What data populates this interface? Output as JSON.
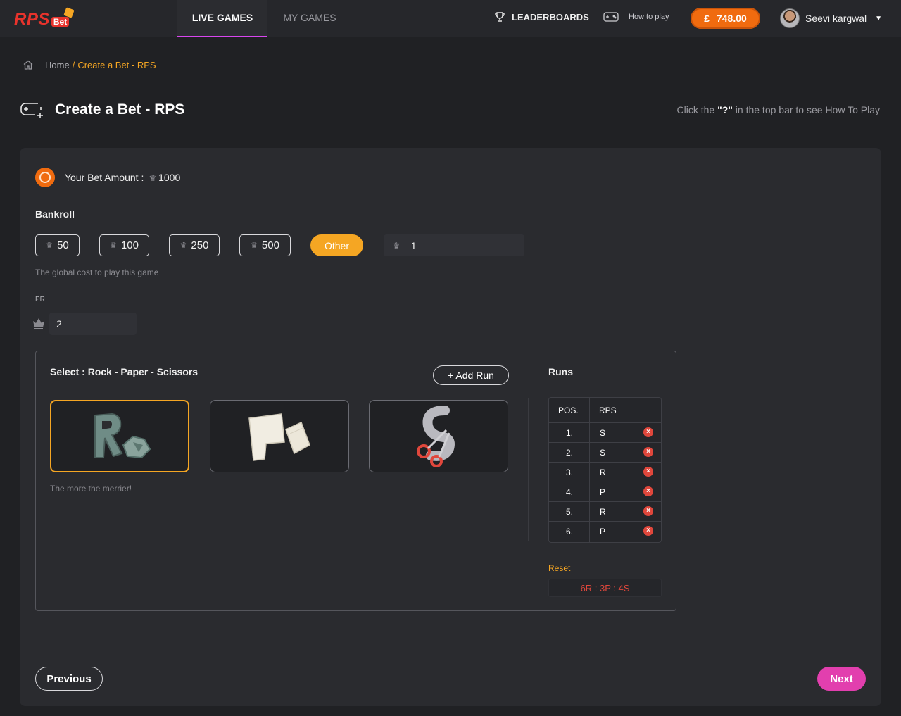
{
  "brand": {
    "logo_text": "RPS",
    "logo_sub": "Bet"
  },
  "nav": {
    "tabs": [
      {
        "label": "LIVE GAMES",
        "active": true
      },
      {
        "label": "MY GAMES",
        "active": false
      }
    ],
    "leaderboards_label": "LEADERBOARDS",
    "how_to_play_label": "How to play",
    "balance": {
      "currency": "£",
      "amount": "748.00"
    },
    "user_name": "Seevi kargwal"
  },
  "breadcrumb": {
    "home": "Home",
    "separator": "/",
    "current": "Create a Bet - RPS"
  },
  "page": {
    "title": "Create a Bet - RPS",
    "hint_prefix": "Click the",
    "hint_key": "\"?\"",
    "hint_suffix": "in the top bar to see How To Play"
  },
  "bet": {
    "amount_label": "Your Bet Amount :",
    "amount_value": "1000",
    "bankroll_label": "Bankroll",
    "bankroll_options": [
      "50",
      "100",
      "250",
      "500"
    ],
    "other_label": "Other",
    "custom_value": "1",
    "helper_text": "The global cost to play this game",
    "pr_label": "PR",
    "pr_value": "2"
  },
  "selection": {
    "title": "Select : Rock - Paper - Scissors",
    "add_run_label": "+ Add Run",
    "options": [
      {
        "name": "Rock",
        "selected": true
      },
      {
        "name": "Paper",
        "selected": false
      },
      {
        "name": "Scissors",
        "selected": false
      }
    ],
    "note": "The more the merrier!"
  },
  "runs": {
    "title": "Runs",
    "columns": [
      "POS.",
      "RPS"
    ],
    "rows": [
      {
        "pos": "1.",
        "rps": "S"
      },
      {
        "pos": "2.",
        "rps": "S"
      },
      {
        "pos": "3.",
        "rps": "R"
      },
      {
        "pos": "4.",
        "rps": "P"
      },
      {
        "pos": "5.",
        "rps": "R"
      },
      {
        "pos": "6.",
        "rps": "P"
      }
    ],
    "reset_label": "Reset",
    "summary": "6R : 3P : 4S"
  },
  "footer": {
    "previous_label": "Previous",
    "next_label": "Next"
  },
  "colors": {
    "accent_orange": "#f5a623",
    "balance_orange": "#f06b0f",
    "next_pink": "#e23fae",
    "error_red": "#e0473c",
    "tab_underline": "#d946ef"
  }
}
